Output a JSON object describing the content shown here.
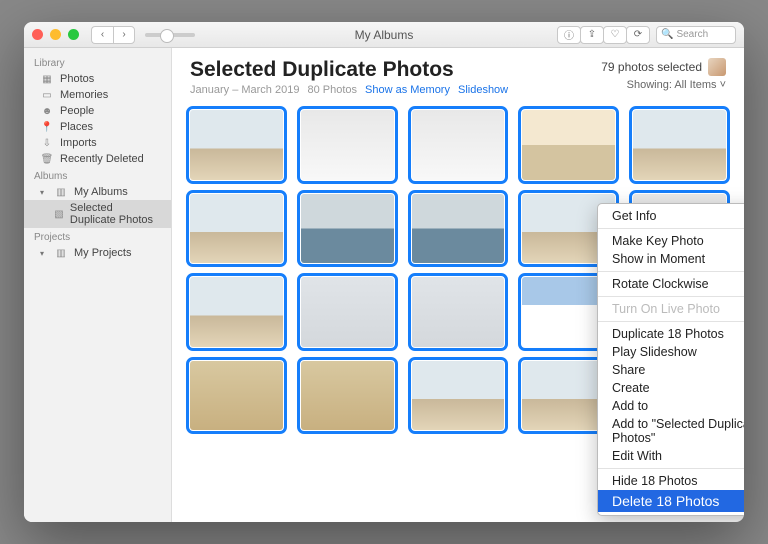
{
  "window_title": "My Albums",
  "search_placeholder": "Search",
  "sidebar": {
    "groups": {
      "library": "Library",
      "albums": "Albums",
      "projects": "Projects"
    },
    "library_items": [
      "Photos",
      "Memories",
      "People",
      "Places",
      "Imports",
      "Recently Deleted"
    ],
    "albums_items": [
      "My Albums",
      "Selected Duplicate Photos"
    ],
    "projects_items": [
      "My Projects"
    ]
  },
  "header": {
    "title": "Selected Duplicate Photos",
    "date_range": "January – March 2019",
    "count": "80 Photos",
    "show_as_memory": "Show as Memory",
    "slideshow": "Slideshow",
    "selected": "79 photos selected",
    "showing": "Showing: All Items"
  },
  "context_menu": {
    "get_info": "Get Info",
    "make_key": "Make Key Photo",
    "show_moment": "Show in Moment",
    "rotate": "Rotate Clockwise",
    "live_photo": "Turn On Live Photo",
    "duplicate": "Duplicate 18 Photos",
    "play_slideshow": "Play Slideshow",
    "share": "Share",
    "create": "Create",
    "add_to": "Add to",
    "add_to_album": "Add to \"Selected Duplicate Photos\"",
    "edit_with": "Edit With",
    "hide": "Hide 18 Photos",
    "delete": "Delete 18 Photos"
  }
}
